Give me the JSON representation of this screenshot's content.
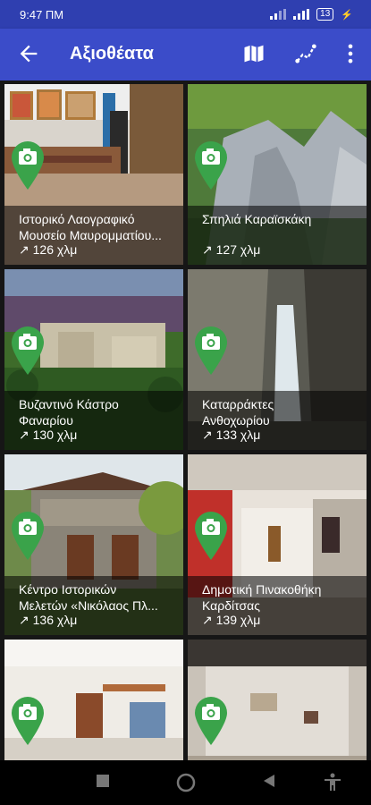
{
  "status_bar": {
    "time": "9:47 ΠΜ",
    "battery": "13"
  },
  "app_bar": {
    "title": "Αξιοθέατα",
    "back_icon": "arrow-back-icon",
    "actions": [
      "map-icon",
      "route-icon",
      "more-vert-icon"
    ]
  },
  "colors": {
    "primary": "#3b4cc9",
    "status": "#2f3fb0",
    "pin": "#3aa34a"
  },
  "attractions": [
    {
      "name_line1": "Ιστορικό Λαογραφικό",
      "name_line2": "Μουσείο Μαυρομματίου...",
      "distance": "↗ 126 χλμ"
    },
    {
      "name_line1": "Σπηλιά Καραϊσκάκη",
      "name_line2": "",
      "distance": "↗ 127 χλμ"
    },
    {
      "name_line1": "Βυζαντινό Κάστρο",
      "name_line2": "Φαναρίου",
      "distance": "↗ 130 χλμ"
    },
    {
      "name_line1": "Καταρράκτες",
      "name_line2": "Ανθοχωρίου",
      "distance": "↗ 133 χλμ"
    },
    {
      "name_line1": "Κέντρο Ιστορικών",
      "name_line2": "Μελετών «Νικόλαος Πλ...",
      "distance": "↗ 136 χλμ"
    },
    {
      "name_line1": "Δημοτική Πινακοθήκη",
      "name_line2": "Καρδίτσας",
      "distance": "↗ 139 χλμ"
    },
    {
      "name_line1": "",
      "name_line2": "",
      "distance": ""
    },
    {
      "name_line1": "",
      "name_line2": "",
      "distance": ""
    }
  ],
  "nav_bar": [
    "recents-square-icon",
    "home-circle-icon",
    "back-triangle-icon",
    "accessibility-icon"
  ]
}
